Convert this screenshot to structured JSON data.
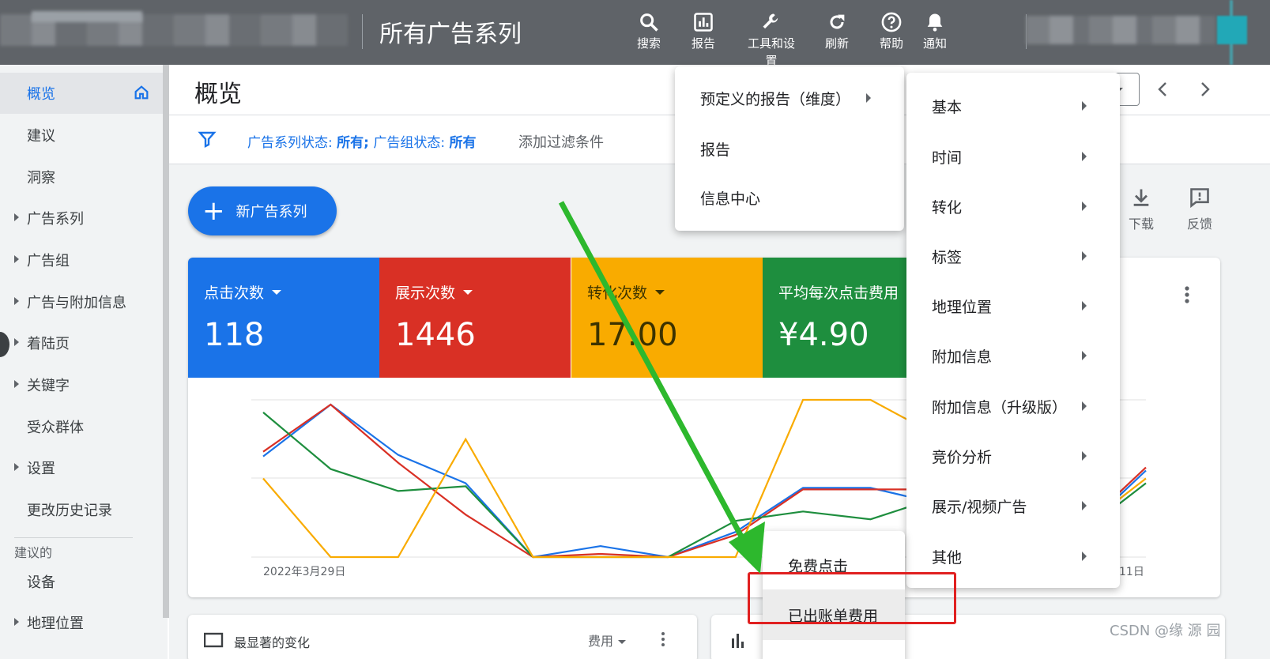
{
  "topbar": {
    "page_title": "所有广告系列",
    "buttons": [
      {
        "label": "搜索",
        "icon": "search-icon"
      },
      {
        "label": "报告",
        "icon": "reports-icon"
      },
      {
        "label": "工具和设置",
        "icon": "wrench-icon"
      },
      {
        "label": "刷新",
        "icon": "refresh-icon"
      },
      {
        "label": "帮助",
        "icon": "help-icon"
      },
      {
        "label": "通知",
        "icon": "bell-icon"
      }
    ]
  },
  "sidebar": {
    "items": [
      {
        "label": "概览",
        "active": true,
        "icon": "home-icon"
      },
      {
        "label": "建议"
      },
      {
        "label": "洞察"
      },
      {
        "label": "广告系列",
        "expandable": true
      },
      {
        "label": "广告组",
        "expandable": true
      },
      {
        "label": "广告与附加信息",
        "expandable": true
      },
      {
        "label": "着陆页",
        "expandable": true
      },
      {
        "label": "关键字",
        "expandable": true
      },
      {
        "label": "受众群体"
      },
      {
        "label": "设置",
        "expandable": true
      },
      {
        "label": "更改历史记录"
      }
    ],
    "section_label": "建议的",
    "section_items": [
      {
        "label": "设备"
      },
      {
        "label": "地理位置",
        "expandable": true
      }
    ]
  },
  "main": {
    "title": "概览",
    "filter_prefix": "广告系列状态:",
    "filter_value1": "所有;",
    "filter_mid": " 广告组状态:",
    "filter_value2": "所有",
    "add_filter": "添加过滤条件",
    "new_campaign": "新广告系列",
    "download": "下载",
    "feedback": "反馈"
  },
  "metrics": [
    {
      "label": "点击次数",
      "value": "118",
      "color": "#1a73e8"
    },
    {
      "label": "展示次数",
      "value": "1446",
      "color": "#d93025"
    },
    {
      "label": "转化次数",
      "value": "17.00",
      "color": "#f9ab00"
    },
    {
      "label": "平均每次点击费用",
      "value": "¥4.90",
      "color": "#1e8e3e"
    }
  ],
  "chart_data": {
    "type": "line",
    "x_start_label": "2022年3月29日",
    "x_end_label": "11日",
    "grid": true,
    "series": [
      {
        "color": "#1a73e8",
        "values": [
          0.64,
          0.97,
          0.65,
          0.47,
          0.0,
          0.07,
          0.0,
          0.16,
          0.44,
          0.44,
          0.34
        ]
      },
      {
        "color": "#d93025",
        "values": [
          0.67,
          0.97,
          0.6,
          0.27,
          0.0,
          0.02,
          0.0,
          0.14,
          0.43,
          0.43,
          0.43
        ]
      },
      {
        "color": "#1e8e3e",
        "values": [
          0.92,
          0.56,
          0.42,
          0.45,
          0.0,
          0.0,
          0.0,
          0.23,
          0.29,
          0.24,
          0.38
        ]
      },
      {
        "color": "#f9ab00",
        "values": [
          0.5,
          0.0,
          0.0,
          0.75,
          0.0,
          0.0,
          0.0,
          0.0,
          1.0,
          1.0,
          0.77
        ]
      }
    ],
    "right_series_tail": [
      {
        "color": "#1a73e8",
        "values": [
          0.38,
          0.55
        ]
      },
      {
        "color": "#d93025",
        "values": [
          0.4,
          0.57
        ]
      },
      {
        "color": "#1e8e3e",
        "values": [
          0.33,
          0.47
        ]
      },
      {
        "color": "#f9ab00",
        "values": [
          0.36,
          0.5
        ]
      }
    ]
  },
  "cards": {
    "card2_title": "最显著的变化",
    "card2_metric": "费用"
  },
  "reports_menu": {
    "items": [
      {
        "label": "预定义的报告（维度）",
        "submenu": true
      },
      {
        "label": "报告"
      },
      {
        "label": "信息中心"
      }
    ]
  },
  "predefined_menu": {
    "items": [
      {
        "label": "基本"
      },
      {
        "label": "时间"
      },
      {
        "label": "转化"
      },
      {
        "label": "标签"
      },
      {
        "label": "地理位置"
      },
      {
        "label": "附加信息"
      },
      {
        "label": "附加信息（升级版）"
      },
      {
        "label": "竞价分析"
      },
      {
        "label": "展示/视频广告"
      },
      {
        "label": "其他"
      }
    ]
  },
  "other_menu": {
    "items": [
      {
        "label": "免费点击"
      },
      {
        "label": "已出账单费用",
        "highlighted": true
      }
    ]
  },
  "annotation": {
    "arrow_color": "#2db82d",
    "box_color": "#e02020"
  },
  "watermark": "CSDN @缘 源 园"
}
